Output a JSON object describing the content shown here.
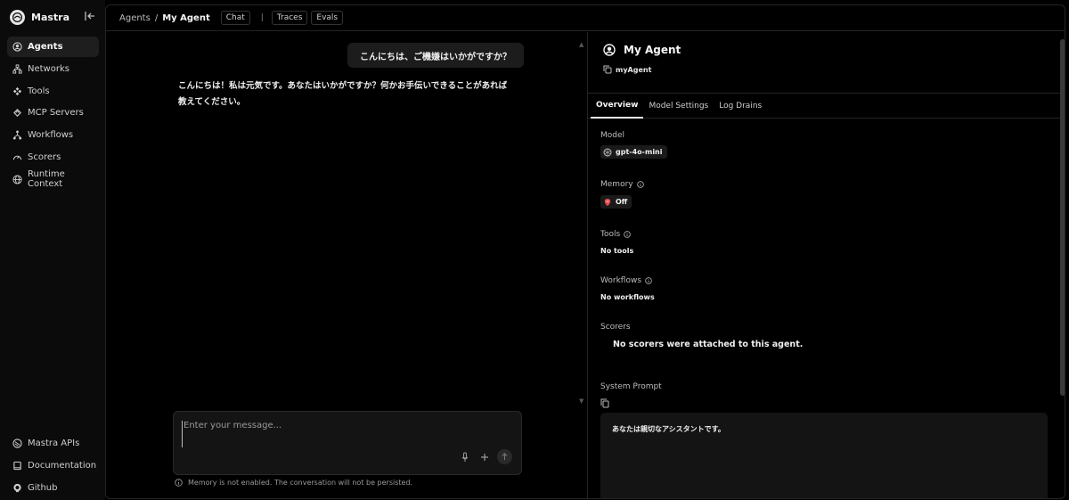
{
  "app": {
    "name": "Mastra"
  },
  "sidebar": {
    "items": [
      {
        "label": "Agents",
        "icon": "agent-icon",
        "active": true
      },
      {
        "label": "Networks",
        "icon": "network-icon"
      },
      {
        "label": "Tools",
        "icon": "tools-icon"
      },
      {
        "label": "MCP Servers",
        "icon": "mcp-icon"
      },
      {
        "label": "Workflows",
        "icon": "workflow-icon"
      },
      {
        "label": "Scorers",
        "icon": "gauge-icon"
      },
      {
        "label": "Runtime Context",
        "icon": "globe-icon"
      }
    ],
    "bottom": [
      {
        "label": "Mastra APIs",
        "icon": "api-icon"
      },
      {
        "label": "Documentation",
        "icon": "book-icon"
      },
      {
        "label": "Github",
        "icon": "github-icon"
      }
    ]
  },
  "header": {
    "breadcrumb_root": "Agents",
    "breadcrumb_sep": "/",
    "breadcrumb_current": "My Agent",
    "tabs": [
      "Chat",
      "Traces",
      "Evals"
    ],
    "divider": "|"
  },
  "chat": {
    "user_message": "こんにちは、ご機嫌はいかがですか？",
    "assistant_message": "こんにちは！私は元気です。あなたはいかがですか？何かお手伝いできることがあれば教えてください。",
    "input_placeholder": "Enter your message...",
    "memory_note": "Memory is not enabled. The conversation will not be persisted."
  },
  "agent": {
    "name": "My Agent",
    "id": "myAgent",
    "tabs": [
      "Overview",
      "Model Settings",
      "Log Drains"
    ],
    "model_label": "Model",
    "model_value": "gpt-4o-mini",
    "memory_label": "Memory",
    "memory_value": "Off",
    "tools_label": "Tools",
    "tools_value": "No tools",
    "workflows_label": "Workflows",
    "workflows_value": "No workflows",
    "scorers_label": "Scorers",
    "scorers_value": "No scorers were attached to this agent.",
    "system_prompt_label": "System Prompt",
    "system_prompt": "あなたは親切なアシスタントです。"
  },
  "colors": {
    "background": "#000000",
    "surface": "#141414",
    "border": "#242424",
    "memory_off": "#e5484d"
  }
}
